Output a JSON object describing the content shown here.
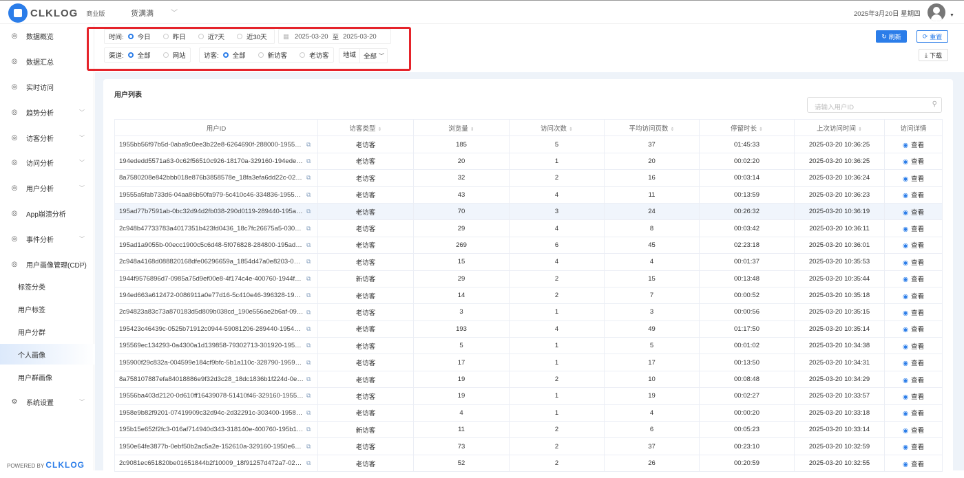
{
  "header": {
    "brand": "CLKLOG",
    "edition": "商业版",
    "org": "货满满",
    "date": "2025年3月20日 星期四"
  },
  "sidebar": {
    "items": [
      {
        "label": "数据概览",
        "icon": "dashboard-icon"
      },
      {
        "label": "数据汇总",
        "icon": "summary-icon"
      },
      {
        "label": "实时访问",
        "icon": "realtime-icon"
      },
      {
        "label": "趋势分析",
        "icon": "trend-icon",
        "chev": true
      },
      {
        "label": "访客分析",
        "icon": "visitor-icon",
        "chev": true
      },
      {
        "label": "访问分析",
        "icon": "tree-icon",
        "chev": true
      },
      {
        "label": "用户分析",
        "icon": "user-icon",
        "chev": true
      },
      {
        "label": "App崩溃分析",
        "icon": "chart-icon"
      },
      {
        "label": "事件分析",
        "icon": "event-icon",
        "chev": true
      },
      {
        "label": "用户画像管理(CDP)",
        "icon": "profile-icon",
        "chev": true
      }
    ],
    "sub": [
      "标签分类",
      "用户标签",
      "用户分群",
      "个人画像",
      "用户群画像"
    ],
    "active": "个人画像",
    "settings": "系统设置",
    "powered": "POWERED BY",
    "powered_brand": "CLKLOG"
  },
  "filters": {
    "time_label": "时间:",
    "time_options": [
      "今日",
      "昨日",
      "近7天",
      "近30天"
    ],
    "time_selected": "今日",
    "date_from": "2025-03-20",
    "date_sep": "至",
    "date_to": "2025-03-20",
    "channel_label": "渠道:",
    "channel_options": [
      "全部",
      "网站"
    ],
    "visitor_label": "访客:",
    "visitor_options": [
      "全部",
      "新访客",
      "老访客"
    ],
    "region_label": "地域",
    "region_value": "全部"
  },
  "actions": {
    "refresh": "刷新",
    "reset": "重置",
    "download": "下载"
  },
  "colors": {
    "accent": "#2b7de9",
    "highlight": "#e5232a"
  },
  "card": {
    "title": "用户列表",
    "search_placeholder": "请输入用户ID"
  },
  "table": {
    "columns": [
      "用户ID",
      "访客类型",
      "浏览量",
      "访问次数",
      "平均访问页数",
      "停留时长",
      "上次访问时间",
      "访问详情"
    ],
    "view_label": "查看",
    "rows": [
      [
        "1955bb56f97b5d-0aba9c0ee3b22e8-6264690f-288000-1955bb...",
        "老访客",
        "185",
        "5",
        "37",
        "01:45:33",
        "2025-03-20 10:36:25"
      ],
      [
        "194ededd5571a63-0c62f56510c926-18170a-329160-194ededd...",
        "老访客",
        "20",
        "1",
        "20",
        "00:02:20",
        "2025-03-20 10:36:25"
      ],
      [
        "8a7580208e842bbb018e876b3858578e_18fa3efa6dd22c-029c...",
        "老访客",
        "32",
        "2",
        "16",
        "00:03:14",
        "2025-03-20 10:36:24"
      ],
      [
        "19555a5fab733d6-04aa86b50fa979-5c410c46-334836-19555a...",
        "老访客",
        "43",
        "4",
        "11",
        "00:13:59",
        "2025-03-20 10:36:23"
      ],
      [
        "195ad77b7591ab-0bc32d94d2fb038-290d0119-289440-195ad7...",
        "老访客",
        "70",
        "3",
        "24",
        "00:26:32",
        "2025-03-20 10:36:19"
      ],
      [
        "2c948b47733783a4017351b423fd0436_18c7fc26675a5-030d6...",
        "老访客",
        "29",
        "4",
        "8",
        "00:03:42",
        "2025-03-20 10:36:11"
      ],
      [
        "195ad1a9055b-00ecc1900c5c6d48-5f076828-284800-195ad1a...",
        "老访客",
        "269",
        "6",
        "45",
        "02:23:18",
        "2025-03-20 10:36:01"
      ],
      [
        "2c948a4168d088820168dfe06296659a_1854d47a0e8203-077...",
        "老访客",
        "15",
        "4",
        "4",
        "00:01:37",
        "2025-03-20 10:35:53"
      ],
      [
        "1944f9576896d7-0985a75d9ef00e8-4f174c4e-400760-1944f95...",
        "新访客",
        "29",
        "2",
        "15",
        "00:13:48",
        "2025-03-20 10:35:44"
      ],
      [
        "194ed663a612472-0086911a0e77d16-5c410e46-396328-194e...",
        "老访客",
        "14",
        "2",
        "7",
        "00:00:52",
        "2025-03-20 10:35:18"
      ],
      [
        "2c94823a83c73a870183d5d809b038cd_190e556ae2b6af-09bff...",
        "老访客",
        "3",
        "1",
        "3",
        "00:00:56",
        "2025-03-20 10:35:15"
      ],
      [
        "195423c46439c-0525b71912c0944-59081206-289440-195423...",
        "老访客",
        "193",
        "4",
        "49",
        "01:17:50",
        "2025-03-20 10:35:14"
      ],
      [
        "195569ec134293-0a4300a1d139858-79302713-301920-19556...",
        "老访客",
        "5",
        "1",
        "5",
        "00:01:02",
        "2025-03-20 10:34:38"
      ],
      [
        "195900f29c832a-004599e184cf9bfc-5b1a110c-328790-195900...",
        "老访客",
        "17",
        "1",
        "17",
        "00:13:50",
        "2025-03-20 10:34:31"
      ],
      [
        "8a758107887efa84018886e9f32d3c28_18dc1836b1f224d-0e8...",
        "老访客",
        "19",
        "2",
        "10",
        "00:08:48",
        "2025-03-20 10:34:29"
      ],
      [
        "19556ba403d2120-0d610ff16439078-51410f46-329160-19556...",
        "老访客",
        "19",
        "1",
        "19",
        "00:02:27",
        "2025-03-20 10:33:57"
      ],
      [
        "1958e9b82f9201-07419909c32d94c-2d32291c-303400-1958e9...",
        "老访客",
        "4",
        "1",
        "4",
        "00:00:20",
        "2025-03-20 10:33:18"
      ],
      [
        "195b15e652f2fc3-016af714940d343-318140e-400760-195b15e...",
        "新访客",
        "11",
        "2",
        "6",
        "00:05:23",
        "2025-03-20 10:33:14"
      ],
      [
        "1950e64fe3877b-0ebf50b2ac5a2e-152610a-329160-1950e64fe...",
        "老访客",
        "73",
        "2",
        "37",
        "00:23:10",
        "2025-03-20 10:32:59"
      ],
      [
        "2c9081ec651820be01651844b2f10009_18f91257d472a7-028e...",
        "老访客",
        "52",
        "2",
        "26",
        "00:20:59",
        "2025-03-20 10:32:55"
      ]
    ]
  }
}
